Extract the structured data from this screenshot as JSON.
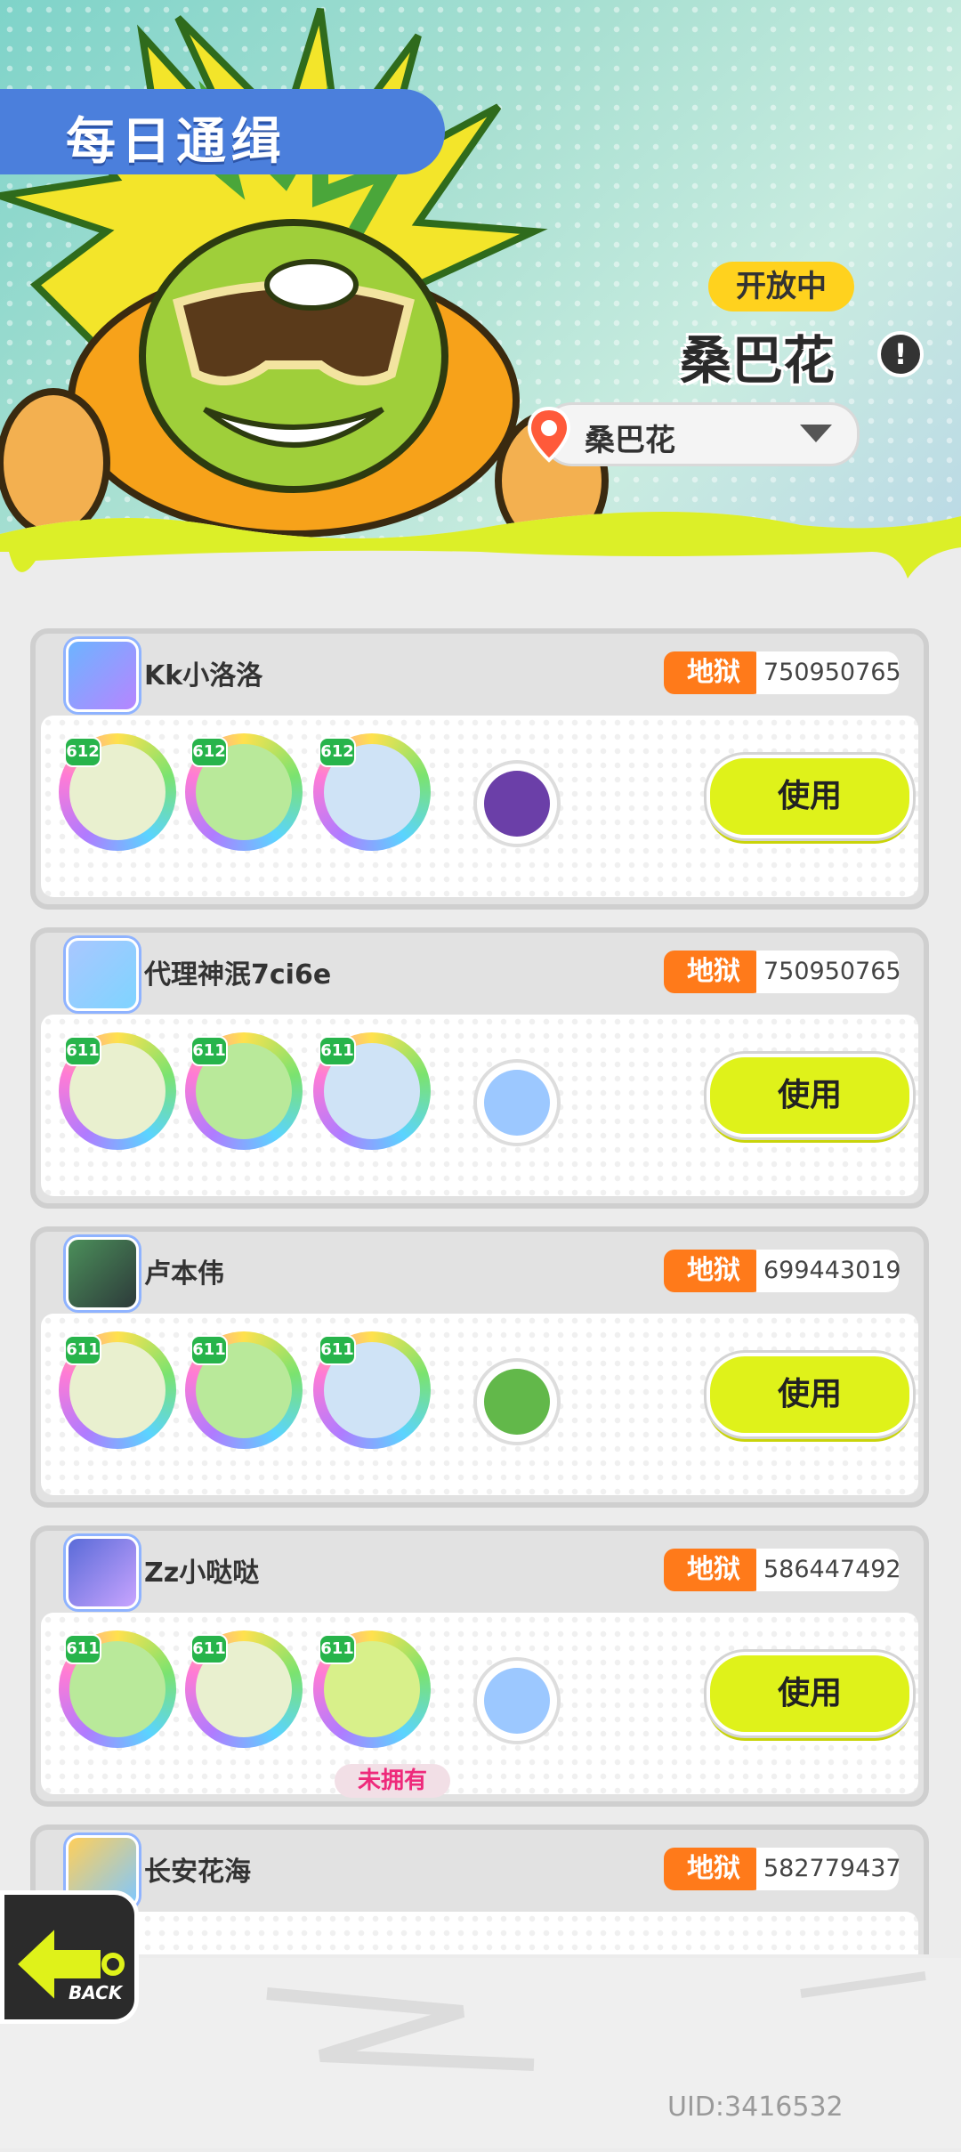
{
  "header": {
    "title": "每日通缉",
    "status_badge": "开放中",
    "boss_name": "桑巴花",
    "info_icon": "exclamation-icon",
    "selector": {
      "value": "桑巴花",
      "icon": "location-pin-icon"
    }
  },
  "entries": [
    {
      "player": "Kk小洛洛",
      "difficulty": "地狱",
      "score": "750950765",
      "levels": [
        "612",
        "612",
        "612"
      ],
      "button": "使用",
      "unowned": ""
    },
    {
      "player": "代理神泯7ci6e",
      "difficulty": "地狱",
      "score": "750950765",
      "levels": [
        "611",
        "611",
        "611"
      ],
      "button": "使用",
      "unowned": ""
    },
    {
      "player": "卢本伟",
      "difficulty": "地狱",
      "score": "699443019",
      "levels": [
        "611",
        "611",
        "611"
      ],
      "button": "使用",
      "unowned": ""
    },
    {
      "player": "Zz小哒哒",
      "difficulty": "地狱",
      "score": "586447492",
      "levels": [
        "611",
        "611",
        "611"
      ],
      "button": "使用",
      "unowned": "未拥有"
    },
    {
      "player": "长安花海",
      "difficulty": "地狱",
      "score": "582779437",
      "levels": [
        "",
        "",
        ""
      ],
      "button": "",
      "unowned": ""
    }
  ],
  "footer": {
    "back_label": "BACK",
    "uid": "UID:3416532"
  },
  "colors": {
    "accent_yellow": "#dff21a",
    "difficulty_orange": "#ff7a1a",
    "title_blue": "#4b7fdc",
    "unowned_pink": "#ee2a7b"
  }
}
